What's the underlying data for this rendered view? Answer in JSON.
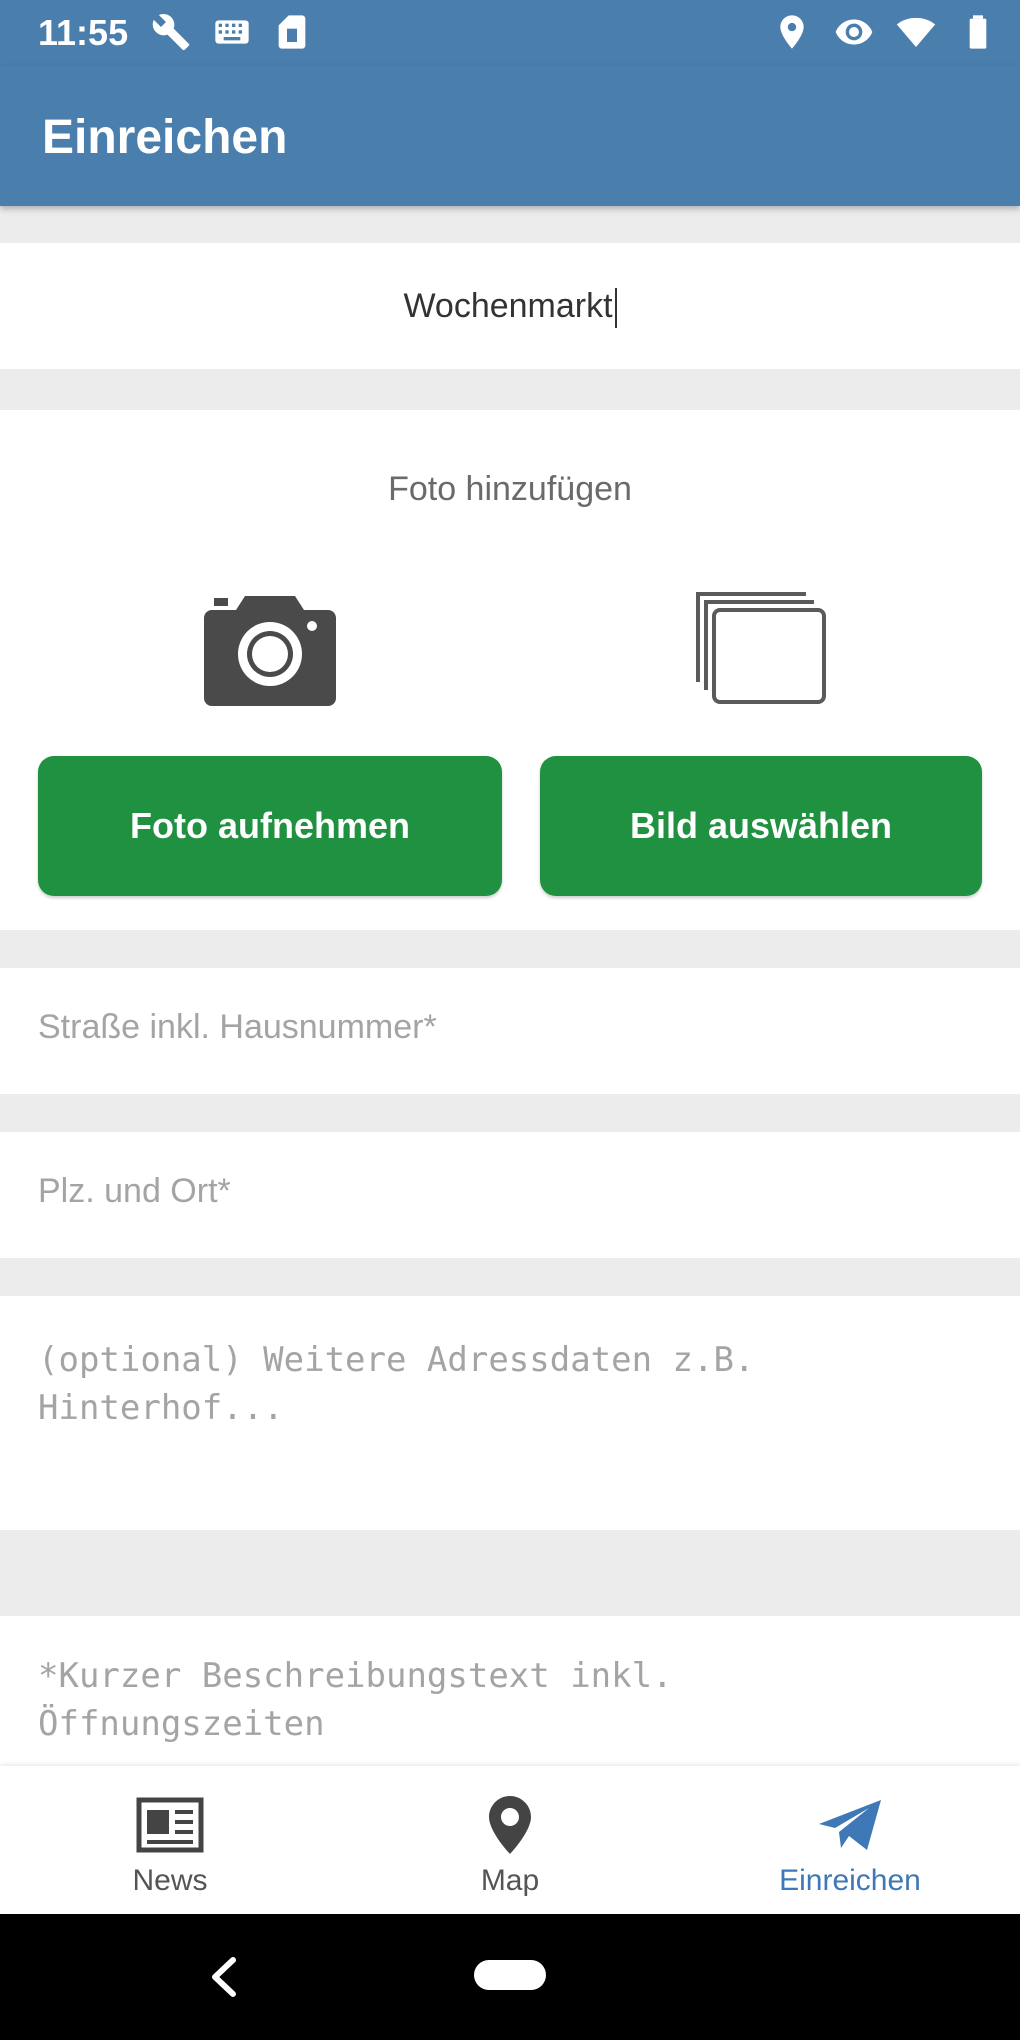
{
  "status_bar": {
    "time": "11:55",
    "left_icons": [
      "wrench-icon",
      "keyboard-icon",
      "sd-card-icon"
    ],
    "right_icons": [
      "location-icon",
      "eye-icon",
      "wifi-icon",
      "battery-icon"
    ]
  },
  "app_bar": {
    "title": "Einreichen"
  },
  "title_field": {
    "value": "Wochenmarkt"
  },
  "photo_section": {
    "label": "Foto hinzufügen",
    "take_photo_button": "Foto aufnehmen",
    "choose_image_button": "Bild auswählen",
    "button_color": "#1f9140"
  },
  "address": {
    "street_placeholder": "Straße inkl. Hausnummer*",
    "plz_placeholder": "Plz. und Ort*",
    "optional_placeholder": "(optional) Weitere Adressdaten z.B.\nHinterhof..."
  },
  "description": {
    "placeholder": "*Kurzer Beschreibungstext inkl.\nÖffnungszeiten"
  },
  "bottom_nav": {
    "items": [
      {
        "label": "News",
        "icon": "news-icon",
        "active": false
      },
      {
        "label": "Map",
        "icon": "map-pin-icon",
        "active": false
      },
      {
        "label": "Einreichen",
        "icon": "send-icon",
        "active": true
      }
    ]
  },
  "colors": {
    "primary": "#4a7ead",
    "active_nav": "#3f78b6",
    "background": "#ececec"
  }
}
